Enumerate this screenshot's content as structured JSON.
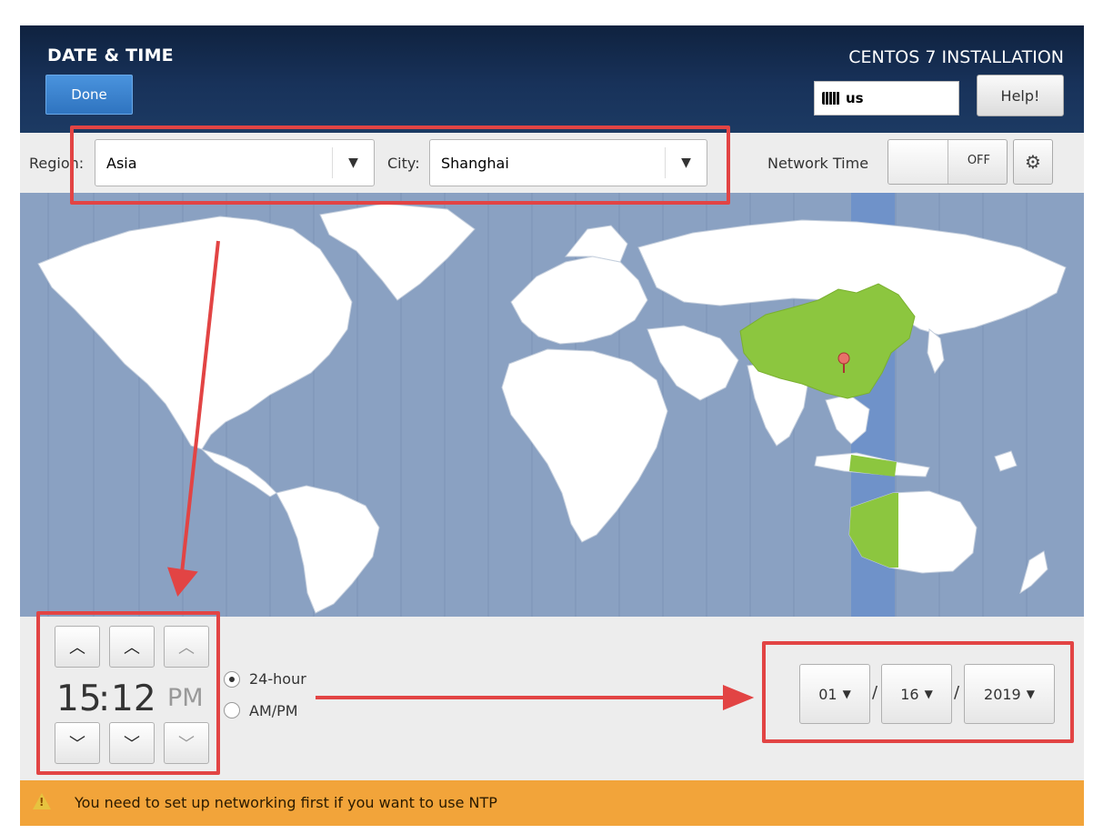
{
  "header": {
    "spoke_title": "DATE & TIME",
    "done_label": "Done",
    "product_title": "CENTOS 7 INSTALLATION",
    "keyboard_layout": "us",
    "help_label": "Help!"
  },
  "location": {
    "region_label": "Region:",
    "region_value": "Asia",
    "city_label": "City:",
    "city_value": "Shanghai",
    "network_time_label": "Network Time",
    "network_time_state": "OFF"
  },
  "time": {
    "hours": "15",
    "separator": ":",
    "minutes": "12",
    "ampm": "PM",
    "format_24h_label": "24-hour",
    "format_ampm_label": "AM/PM",
    "selected_format": "24-hour"
  },
  "date": {
    "month": "01",
    "day": "16",
    "year": "2019",
    "separator": "/"
  },
  "warning": {
    "text": "You need to set up networking first if you want to use NTP"
  },
  "colors": {
    "header_bg": "#18325a",
    "done_button": "#3b82cf",
    "map_ocean": "#8aa1c2",
    "map_land": "#ffffff",
    "selected_zone": "#6f92c9",
    "selected_country": "#8cc63f",
    "warning_bg": "#f2a43a",
    "annotation_red": "#e24444"
  },
  "icons": {
    "keyboard": "keyboard-icon",
    "dropdown": "chevron-down-icon",
    "gear": "gear-icon",
    "pin": "map-pin-icon",
    "warning": "warning-icon"
  }
}
